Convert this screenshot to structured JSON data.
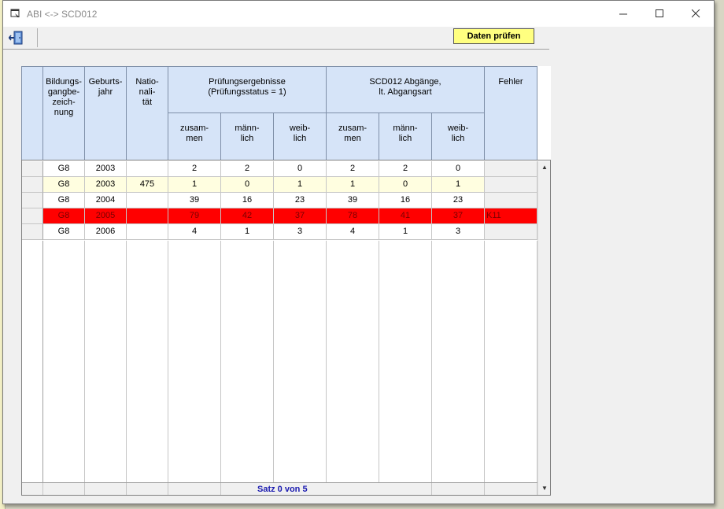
{
  "window": {
    "title": "ABI <-> SCD012",
    "controls": {
      "minimize": "—",
      "maximize": "☐",
      "close": "✕"
    }
  },
  "toolbar": {
    "exit_icon": "exit-door-icon",
    "check_label": "Daten prüfen",
    "check_color": "#ffff80"
  },
  "table": {
    "headers": {
      "bildung": "Bildungs-\ngangbe-\nzeich-\nnung",
      "geburt": "Geburts-\njahr",
      "nation": "Natio-\nnali-\ntät",
      "pruef_group": "Prüfungsergebnisse\n(Prüfungsstatus = 1)",
      "scd_group": "SCD012 Abgänge,\nlt. Abgangsart",
      "fehler": "Fehler",
      "zusammen": "zusam-\nmen",
      "maennlich": "männ-\nlich",
      "weiblich": "weib-\nlich"
    },
    "rows": [
      {
        "bildung": "G8",
        "jahr": "2003",
        "nation": "",
        "p_z": "2",
        "p_m": "2",
        "p_w": "0",
        "s_z": "2",
        "s_m": "2",
        "s_w": "0",
        "fehler": "",
        "style": "white"
      },
      {
        "bildung": "G8",
        "jahr": "2003",
        "nation": "475",
        "p_z": "1",
        "p_m": "0",
        "p_w": "1",
        "s_z": "1",
        "s_m": "0",
        "s_w": "1",
        "fehler": "",
        "style": "light"
      },
      {
        "bildung": "G8",
        "jahr": "2004",
        "nation": "",
        "p_z": "39",
        "p_m": "16",
        "p_w": "23",
        "s_z": "39",
        "s_m": "16",
        "s_w": "23",
        "fehler": "",
        "style": "white"
      },
      {
        "bildung": "G8",
        "jahr": "2005",
        "nation": "",
        "p_z": "79",
        "p_m": "42",
        "p_w": "37",
        "s_z": "78",
        "s_m": "41",
        "s_w": "37",
        "fehler": "K11",
        "style": "red"
      },
      {
        "bildung": "G8",
        "jahr": "2006",
        "nation": "",
        "p_z": "4",
        "p_m": "1",
        "p_w": "3",
        "s_z": "4",
        "s_m": "1",
        "s_w": "3",
        "fehler": "",
        "style": "white"
      }
    ],
    "status": "Satz 0 von 5",
    "colors": {
      "header": "#d6e4f8",
      "error_row": "#ff0000",
      "alt_row": "#fffee0",
      "status_text": "#1b1bb0"
    }
  }
}
